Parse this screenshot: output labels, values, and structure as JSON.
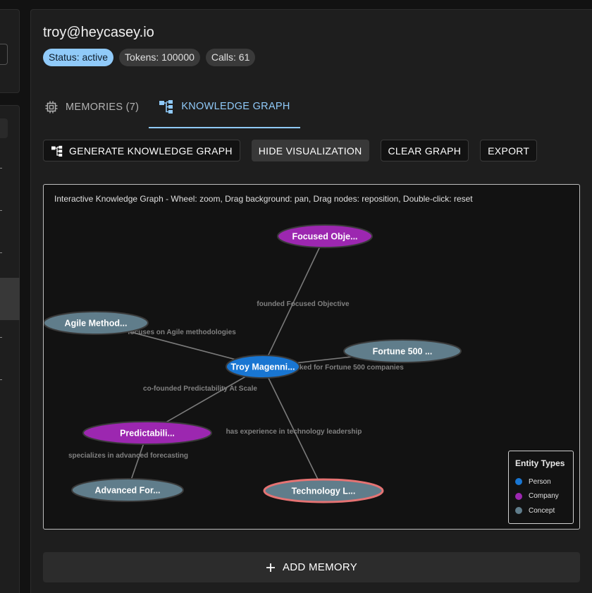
{
  "user": {
    "email": "troy@heycasey.io"
  },
  "chips": {
    "status": "Status: active",
    "tokens": "Tokens: 100000",
    "calls": "Calls: 61"
  },
  "tabs": {
    "memories": "MEMORIES (7)",
    "knowledge_graph": "KNOWLEDGE GRAPH"
  },
  "actions": {
    "generate": "GENERATE KNOWLEDGE GRAPH",
    "hide": "HIDE VISUALIZATION",
    "clear": "CLEAR GRAPH",
    "export": "EXPORT"
  },
  "graph": {
    "caption": "Interactive Knowledge Graph - Wheel: zoom, Drag background: pan, Drag nodes: reposition, Double-click: reset",
    "nodes": [
      {
        "id": "troy",
        "label": "Troy Magenni...",
        "type": "person"
      },
      {
        "id": "focused",
        "label": "Focused Obje...",
        "type": "company"
      },
      {
        "id": "agile",
        "label": "Agile Method...",
        "type": "concept"
      },
      {
        "id": "fortune",
        "label": "Fortune 500 ...",
        "type": "concept"
      },
      {
        "id": "predict",
        "label": "Predictabili...",
        "type": "company"
      },
      {
        "id": "advanced",
        "label": "Advanced For...",
        "type": "concept"
      },
      {
        "id": "tech",
        "label": "Technology L...",
        "type": "concept",
        "highlighted": true
      }
    ],
    "edges": [
      {
        "from": "troy",
        "to": "focused",
        "label": "founded Focused Objective"
      },
      {
        "from": "troy",
        "to": "agile",
        "label": "focuses on Agile methodologies"
      },
      {
        "from": "troy",
        "to": "fortune",
        "label": "worked for Fortune 500 companies"
      },
      {
        "from": "troy",
        "to": "predict",
        "label": "co-founded Predictability At Scale"
      },
      {
        "from": "troy",
        "to": "tech",
        "label": "has experience in technology leadership"
      },
      {
        "from": "predict",
        "to": "advanced",
        "label": "specializes in advanced forecasting"
      }
    ]
  },
  "legend": {
    "title": "Entity Types",
    "items": [
      {
        "label": "Person",
        "color": "#1976d2"
      },
      {
        "label": "Company",
        "color": "#9c27b0"
      },
      {
        "label": "Concept",
        "color": "#607d8b"
      }
    ]
  },
  "colors": {
    "person": "#1976d2",
    "company": "#9c27b0",
    "concept": "#607d8b",
    "highlight": "#e57373",
    "accent": "#90caf9"
  },
  "add_memory": "ADD MEMORY"
}
